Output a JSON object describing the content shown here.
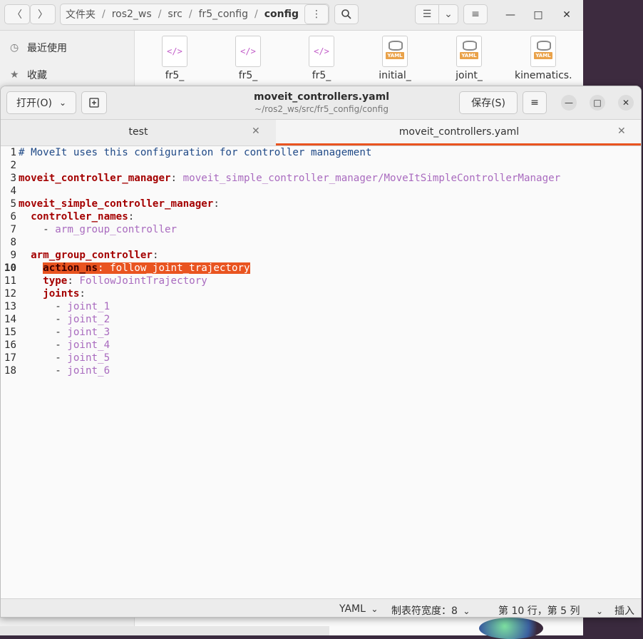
{
  "file_manager": {
    "path": [
      "文件夹",
      "ros2_ws",
      "src",
      "fr5_config",
      "config"
    ],
    "sidebar": [
      {
        "label": "最近使用",
        "icon": "clock-icon"
      },
      {
        "label": "收藏",
        "icon": "star-icon"
      }
    ],
    "files": [
      {
        "name": "fr5_",
        "type": "xml"
      },
      {
        "name": "fr5_",
        "type": "xml"
      },
      {
        "name": "fr5_",
        "type": "xml"
      },
      {
        "name": "initial_",
        "type": "yaml"
      },
      {
        "name": "joint_",
        "type": "yaml"
      },
      {
        "name": "kinematics.",
        "type": "yaml"
      }
    ],
    "yaml_badge": "YAML"
  },
  "editor": {
    "open_label": "打开(O)",
    "save_label": "保存(S)",
    "title": "moveit_controllers.yaml",
    "subtitle": "~/ros2_ws/src/fr5_config/config",
    "tabs": [
      {
        "label": "test",
        "active": false
      },
      {
        "label": "moveit_controllers.yaml",
        "active": true
      }
    ],
    "current_line": 10,
    "lines": [
      {
        "n": "1",
        "t": "# MoveIt uses this configuration for controller management"
      },
      {
        "n": "2",
        "t": ""
      },
      {
        "n": "3",
        "t": "moveit_controller_manager: moveit_simple_controller_manager/MoveItSimpleControllerManager"
      },
      {
        "n": "4",
        "t": ""
      },
      {
        "n": "5",
        "t": "moveit_simple_controller_manager:"
      },
      {
        "n": "6",
        "t": "  controller_names:"
      },
      {
        "n": "7",
        "t": "    - arm_group_controller"
      },
      {
        "n": "8",
        "t": ""
      },
      {
        "n": "9",
        "t": "  arm_group_controller:"
      },
      {
        "n": "10",
        "t": "    action_ns: follow_joint_trajectory"
      },
      {
        "n": "11",
        "t": "    type: FollowJointTrajectory"
      },
      {
        "n": "12",
        "t": "    joints:"
      },
      {
        "n": "13",
        "t": "      - joint_1"
      },
      {
        "n": "14",
        "t": "      - joint_2"
      },
      {
        "n": "15",
        "t": "      - joint_3"
      },
      {
        "n": "16",
        "t": "      - joint_4"
      },
      {
        "n": "17",
        "t": "      - joint_5"
      },
      {
        "n": "18",
        "t": "      - joint_6"
      }
    ],
    "status": {
      "language": "YAML",
      "tab_width": "制表符宽度：8",
      "position": "第 10 行，第 5 列",
      "mode": "插入"
    }
  },
  "colors": {
    "accent": "#e95420",
    "key": "#a40000",
    "value": "#a96bbf",
    "comment": "#204a87"
  }
}
